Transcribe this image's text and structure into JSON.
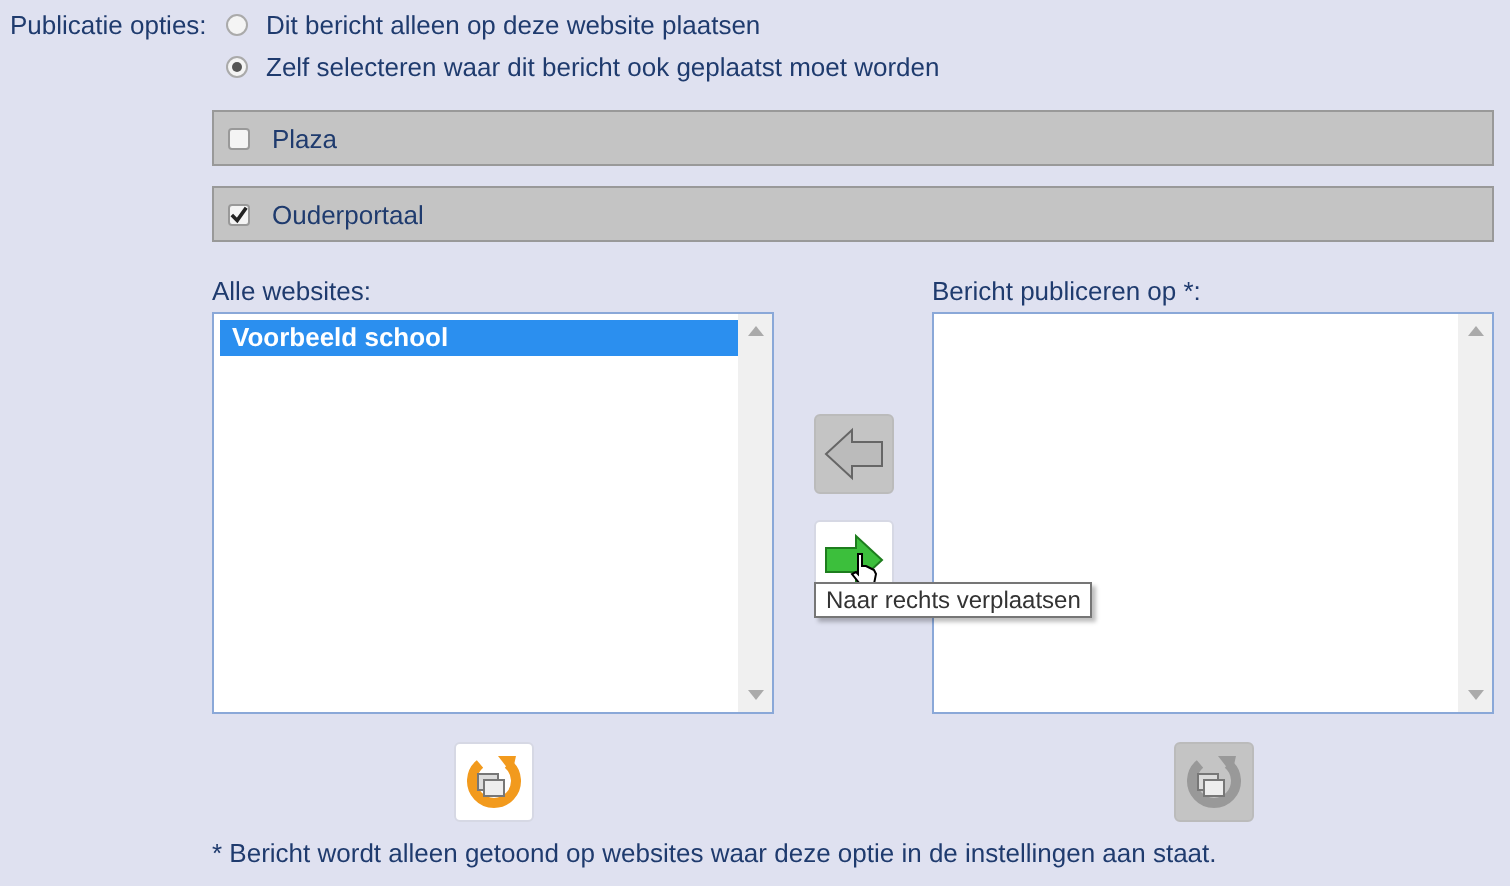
{
  "publication_options": {
    "label": "Publicatie opties:",
    "radios": [
      {
        "label": "Dit bericht alleen op deze website plaatsen",
        "selected": false
      },
      {
        "label": "Zelf selecteren waar dit bericht ook geplaatst moet worden",
        "selected": true
      }
    ]
  },
  "portals": [
    {
      "label": "Plaza",
      "checked": false
    },
    {
      "label": "Ouderportaal",
      "checked": true
    }
  ],
  "all_websites": {
    "label": "Alle websites:",
    "items": [
      {
        "label": "Voorbeeld school",
        "selected": true
      }
    ]
  },
  "publish_on": {
    "label": "Bericht publiceren op *:"
  },
  "move_buttons": [
    {
      "kind": "left",
      "disabled": true
    },
    {
      "kind": "right",
      "disabled": false
    }
  ],
  "tooltip": "Naar rechts verplaatsen",
  "reset_buttons": [
    {
      "disabled": false
    },
    {
      "disabled": true
    }
  ],
  "footnote": "* Bericht wordt alleen getoond op websites waar deze optie in de instellingen aan staat."
}
